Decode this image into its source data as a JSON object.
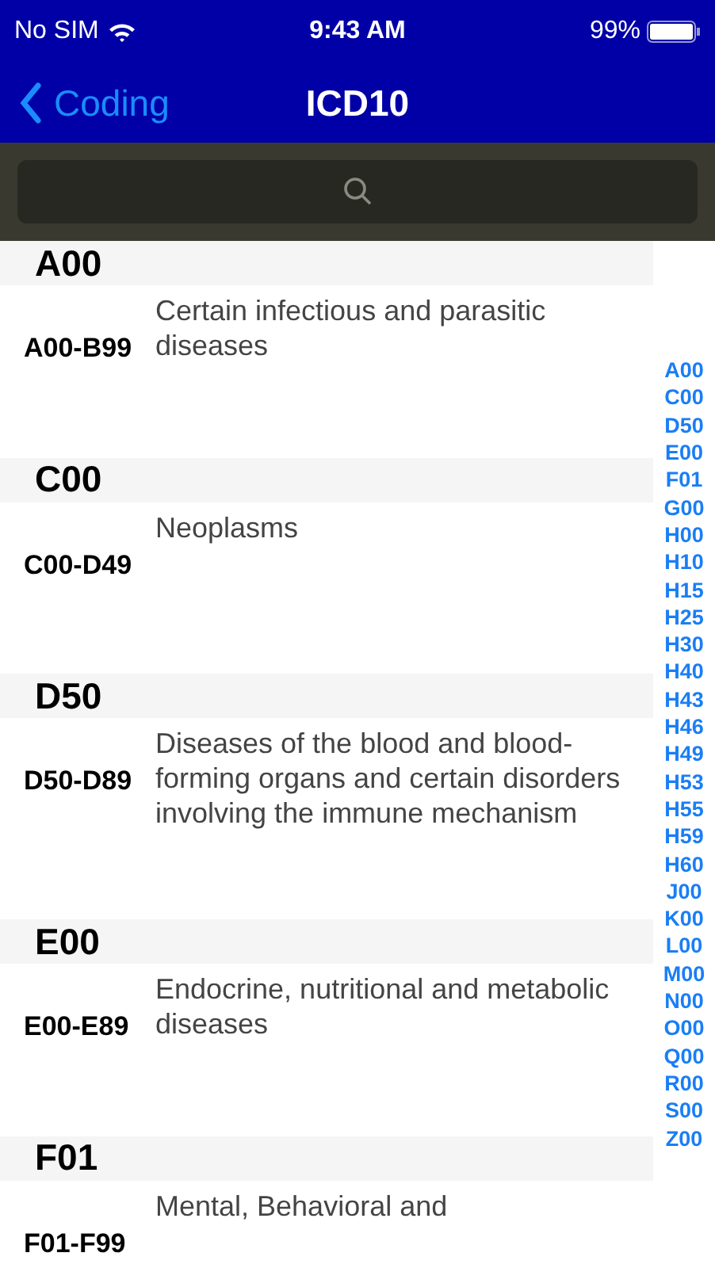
{
  "status_bar": {
    "carrier": "No SIM",
    "time": "9:43 AM",
    "battery": "99%"
  },
  "nav_bar": {
    "back": "Coding",
    "title": "ICD10"
  },
  "sections": [
    {
      "header": "A00",
      "code": "A00-B99",
      "description": "Certain infectious and parasitic diseases"
    },
    {
      "header": "C00",
      "code": "C00-D49",
      "description": "Neoplasms"
    },
    {
      "header": "D50",
      "code": "D50-D89",
      "description": "Diseases of the blood and blood-forming organs and certain disorders involving the immune mechanism"
    },
    {
      "header": "E00",
      "code": "E00-E89",
      "description": "Endocrine, nutritional and metabolic diseases"
    },
    {
      "header": "F01",
      "code": "F01-F99",
      "description": "Mental, Behavioral and"
    }
  ],
  "index": [
    "A00",
    "C00",
    "D50",
    "E00",
    "F01",
    "G00",
    "H00",
    "H10",
    "H15",
    "H25",
    "H30",
    "H40",
    "H43",
    "H46",
    "H49",
    "H53",
    "H55",
    "H59",
    "H60",
    "J00",
    "K00",
    "L00",
    "M00",
    "N00",
    "O00",
    "Q00",
    "R00",
    "S00",
    "Z00"
  ]
}
